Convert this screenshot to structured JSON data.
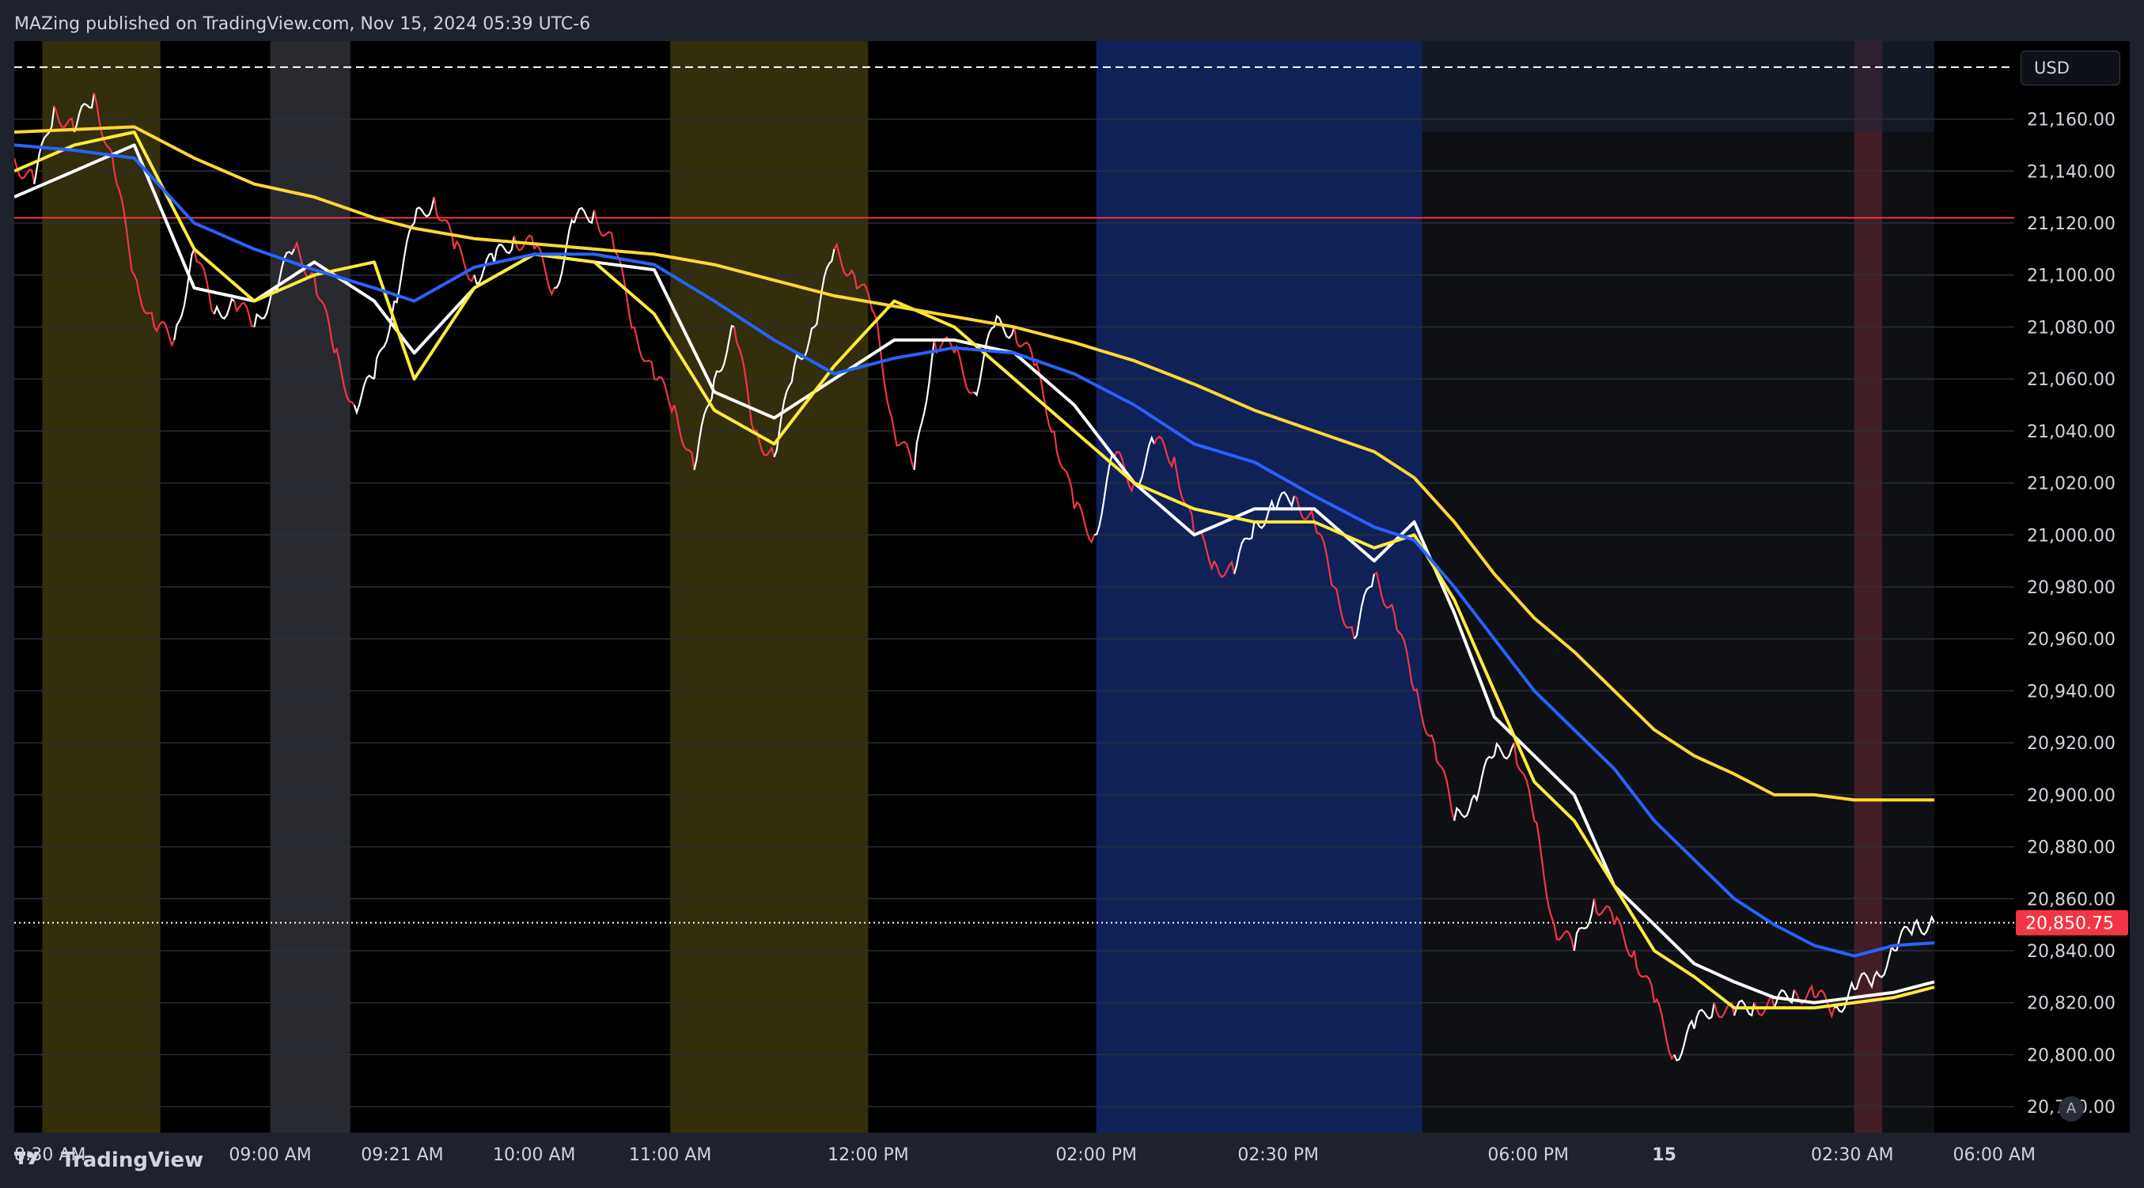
{
  "header": {
    "publisher_text": "MAZing published on TradingView.com, Nov 15, 2024 05:39 UTC-6"
  },
  "price_axis": {
    "currency": "USD",
    "current_price_label": "20,850.75",
    "current_price_color": "#f23645"
  },
  "footer": {
    "brand": "TradingView",
    "auto_scale_label": "A"
  },
  "colors": {
    "up_candle": "#ffffff",
    "down_candle": "#f23645",
    "ema_fast": "#ffffff",
    "ema_mid": "#ffeb3b",
    "ema_blue": "#2962ff",
    "ema_slow": "#fdd835",
    "resistance_line": "#f23645",
    "dashed_line": "#ffffff"
  },
  "chart_data": {
    "type": "line",
    "ylim": [
      20770,
      21190
    ],
    "y_ticks": [
      21160,
      21140,
      21120,
      21100,
      21080,
      21060,
      21040,
      21020,
      21000,
      20980,
      20960,
      20940,
      20920,
      20900,
      20880,
      20860,
      20840,
      20820,
      20800,
      20780
    ],
    "y_tick_labels": [
      "21,160.00",
      "21,140.00",
      "21,120.00",
      "21,100.00",
      "21,080.00",
      "21,060.00",
      "21,040.00",
      "21,020.00",
      "21,000.00",
      "20,980.00",
      "20,960.00",
      "20,940.00",
      "20,920.00",
      "20,900.00",
      "20,880.00",
      "20,860.00",
      "20,840.00",
      "20,820.00",
      "20,800.00",
      "20,780.00"
    ],
    "x_tick_labels": [
      "8:30 AM",
      "09:00 AM",
      "09:21 AM",
      "10:00 AM",
      "11:00 AM",
      "12:00 PM",
      "02:00 PM",
      "02:30 PM",
      "06:00 PM",
      "15",
      "02:30 AM",
      "06:00 AM"
    ],
    "x_tick_positions": [
      0.0,
      0.128,
      0.194,
      0.26,
      0.328,
      0.427,
      0.541,
      0.632,
      0.757,
      0.825,
      0.919,
      0.99
    ],
    "x_domain": [
      0,
      1
    ],
    "session_bands": [
      {
        "from": 0.014,
        "to": 0.073,
        "color": "#5c5414"
      },
      {
        "from": 0.128,
        "to": 0.168,
        "color": "#4a4d55"
      },
      {
        "from": 0.328,
        "to": 0.427,
        "color": "#5c5414"
      },
      {
        "from": 0.541,
        "to": 0.704,
        "color": "#1e3da0"
      },
      {
        "from": 0.704,
        "to": 0.96,
        "color": "#1c1e23"
      },
      {
        "from": 0.92,
        "to": 0.934,
        "color": "#6b2a36"
      }
    ],
    "horizontal_lines": [
      {
        "name": "dashed-level",
        "y": 21180,
        "style": "dashed",
        "color": "#ffffff"
      },
      {
        "name": "resistance-level",
        "y": 21122,
        "style": "solid",
        "color": "#f23645"
      },
      {
        "name": "last-price-level",
        "y": 20850.75,
        "style": "dotted",
        "color": "#ffffff"
      }
    ],
    "price_series": {
      "name": "price",
      "x": [
        0.0,
        0.01,
        0.02,
        0.03,
        0.04,
        0.05,
        0.06,
        0.07,
        0.08,
        0.09,
        0.1,
        0.11,
        0.12,
        0.13,
        0.14,
        0.15,
        0.16,
        0.17,
        0.18,
        0.19,
        0.2,
        0.21,
        0.22,
        0.23,
        0.24,
        0.25,
        0.26,
        0.27,
        0.28,
        0.29,
        0.3,
        0.31,
        0.32,
        0.33,
        0.34,
        0.35,
        0.36,
        0.37,
        0.38,
        0.39,
        0.4,
        0.41,
        0.42,
        0.43,
        0.44,
        0.45,
        0.46,
        0.47,
        0.48,
        0.49,
        0.5,
        0.51,
        0.52,
        0.53,
        0.54,
        0.55,
        0.56,
        0.57,
        0.58,
        0.59,
        0.6,
        0.61,
        0.62,
        0.63,
        0.64,
        0.65,
        0.66,
        0.67,
        0.68,
        0.69,
        0.7,
        0.71,
        0.72,
        0.73,
        0.74,
        0.75,
        0.76,
        0.77,
        0.78,
        0.79,
        0.8,
        0.81,
        0.82,
        0.83,
        0.84,
        0.85,
        0.86,
        0.87,
        0.88,
        0.89,
        0.9,
        0.91,
        0.92,
        0.93,
        0.94,
        0.95,
        0.96
      ],
      "values": [
        21145,
        21135,
        21165,
        21155,
        21170,
        21140,
        21100,
        21080,
        21075,
        21110,
        21085,
        21090,
        21080,
        21095,
        21110,
        21100,
        21070,
        21050,
        21060,
        21090,
        21120,
        21130,
        21110,
        21100,
        21105,
        21115,
        21110,
        21095,
        21120,
        21125,
        21110,
        21080,
        21060,
        21050,
        21025,
        21060,
        21080,
        21040,
        21030,
        21065,
        21080,
        21110,
        21100,
        21085,
        21040,
        21025,
        21075,
        21070,
        21055,
        21080,
        21080,
        21065,
        21040,
        21010,
        21000,
        21030,
        21020,
        21035,
        21030,
        21000,
        20990,
        20985,
        21005,
        21010,
        21015,
        21005,
        20980,
        20960,
        20985,
        20970,
        20940,
        20920,
        20890,
        20900,
        20915,
        20920,
        20890,
        20850,
        20840,
        20860,
        20850,
        20840,
        20820,
        20800,
        20810,
        20820,
        20815,
        20820,
        20818,
        20825,
        20822,
        20818,
        20825,
        20830,
        20840,
        20850,
        20851
      ],
      "up_color": "#ffffff",
      "down_color": "#f23645"
    },
    "series": [
      {
        "name": "",
        "color": "#ffffff",
        "x": [
          0.0,
          0.03,
          0.06,
          0.09,
          0.12,
          0.15,
          0.18,
          0.2,
          0.23,
          0.26,
          0.29,
          0.32,
          0.35,
          0.38,
          0.41,
          0.44,
          0.47,
          0.5,
          0.53,
          0.56,
          0.59,
          0.62,
          0.65,
          0.68,
          0.7,
          0.72,
          0.74,
          0.76,
          0.78,
          0.8,
          0.82,
          0.84,
          0.86,
          0.88,
          0.9,
          0.92,
          0.94,
          0.96
        ],
        "values": [
          21130,
          21140,
          21150,
          21095,
          21090,
          21105,
          21090,
          21070,
          21095,
          21108,
          21105,
          21102,
          21055,
          21045,
          21060,
          21075,
          21075,
          21070,
          21050,
          21020,
          21000,
          21010,
          21010,
          20990,
          21005,
          20970,
          20930,
          20915,
          20900,
          20865,
          20850,
          20835,
          20828,
          20822,
          20820,
          20822,
          20824,
          20828
        ]
      },
      {
        "name": "",
        "color": "#ffeb3b",
        "x": [
          0.0,
          0.03,
          0.06,
          0.09,
          0.12,
          0.15,
          0.18,
          0.2,
          0.23,
          0.26,
          0.29,
          0.32,
          0.35,
          0.38,
          0.41,
          0.44,
          0.47,
          0.5,
          0.53,
          0.56,
          0.59,
          0.62,
          0.65,
          0.68,
          0.7,
          0.72,
          0.74,
          0.76,
          0.78,
          0.8,
          0.82,
          0.84,
          0.86,
          0.88,
          0.9,
          0.92,
          0.94,
          0.96
        ],
        "values": [
          21140,
          21150,
          21155,
          21110,
          21090,
          21100,
          21105,
          21060,
          21095,
          21108,
          21105,
          21085,
          21048,
          21035,
          21065,
          21090,
          21080,
          21060,
          21040,
          21020,
          21010,
          21005,
          21005,
          20995,
          21000,
          20975,
          20940,
          20905,
          20890,
          20865,
          20840,
          20830,
          20818,
          20818,
          20818,
          20820,
          20822,
          20826
        ]
      },
      {
        "name": "",
        "color": "#2962ff",
        "x": [
          0.0,
          0.03,
          0.06,
          0.09,
          0.12,
          0.15,
          0.18,
          0.2,
          0.23,
          0.26,
          0.29,
          0.32,
          0.35,
          0.38,
          0.41,
          0.44,
          0.47,
          0.5,
          0.53,
          0.56,
          0.59,
          0.62,
          0.65,
          0.68,
          0.7,
          0.72,
          0.74,
          0.76,
          0.78,
          0.8,
          0.82,
          0.84,
          0.86,
          0.88,
          0.9,
          0.92,
          0.94,
          0.96
        ],
        "values": [
          21150,
          21148,
          21145,
          21120,
          21110,
          21102,
          21095,
          21090,
          21103,
          21108,
          21108,
          21104,
          21090,
          21075,
          21062,
          21068,
          21072,
          21070,
          21062,
          21050,
          21035,
          21028,
          21015,
          21003,
          20998,
          20980,
          20960,
          20940,
          20925,
          20910,
          20890,
          20875,
          20860,
          20850,
          20842,
          20838,
          20842,
          20843
        ]
      },
      {
        "name": "",
        "color": "#fdd835",
        "x": [
          0.0,
          0.03,
          0.06,
          0.09,
          0.12,
          0.15,
          0.18,
          0.2,
          0.23,
          0.26,
          0.29,
          0.32,
          0.35,
          0.38,
          0.41,
          0.44,
          0.47,
          0.5,
          0.53,
          0.56,
          0.59,
          0.62,
          0.65,
          0.68,
          0.7,
          0.72,
          0.74,
          0.76,
          0.78,
          0.8,
          0.82,
          0.84,
          0.86,
          0.88,
          0.9,
          0.92,
          0.94,
          0.96
        ],
        "values": [
          21155,
          21156,
          21157,
          21145,
          21135,
          21130,
          21122,
          21118,
          21114,
          21112,
          21110,
          21108,
          21104,
          21098,
          21092,
          21088,
          21084,
          21080,
          21074,
          21067,
          21058,
          21048,
          21040,
          21032,
          21022,
          21005,
          20985,
          20968,
          20955,
          20940,
          20925,
          20915,
          20908,
          20900,
          20900,
          20898,
          20898,
          20898
        ]
      }
    ]
  }
}
